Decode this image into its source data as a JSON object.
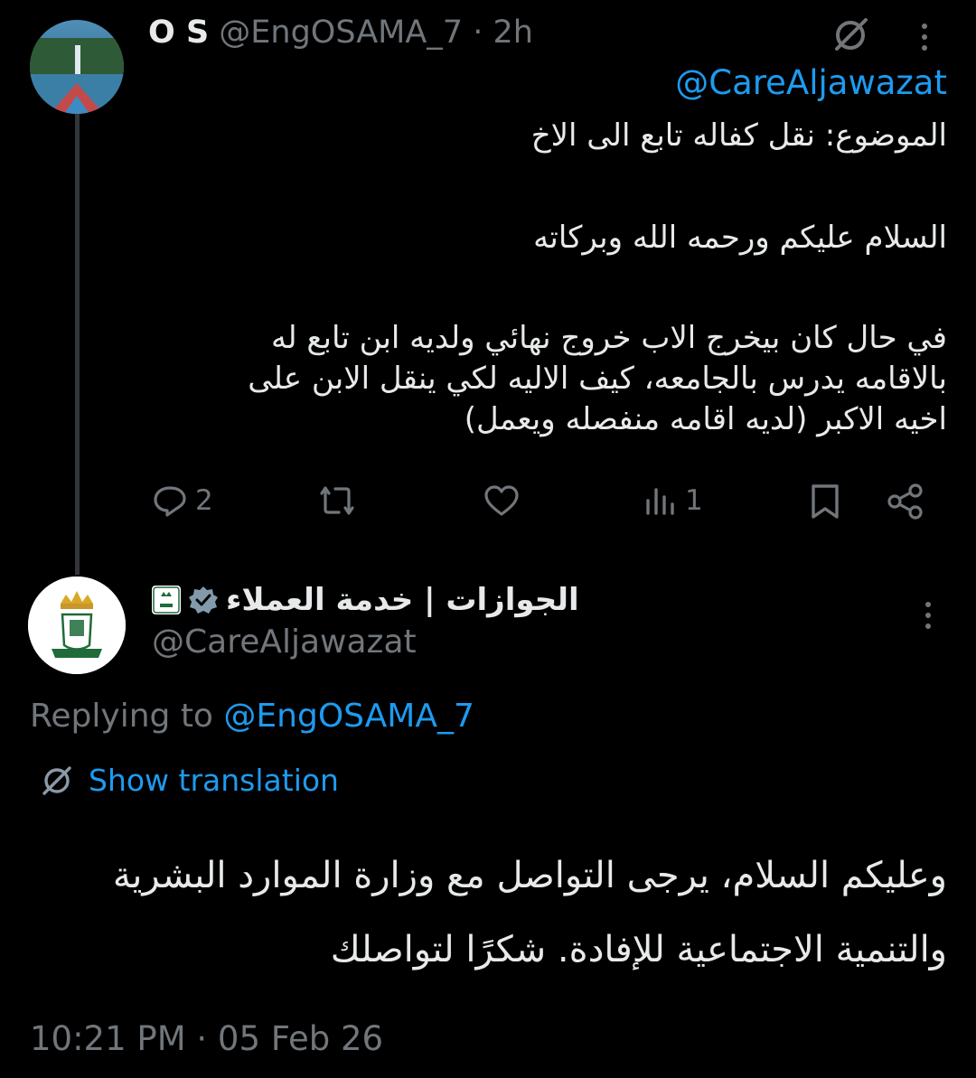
{
  "parent_tweet": {
    "display_name": "O S",
    "handle": "@EngOSAMA_7",
    "separator": "·",
    "time": "2h",
    "mention": "@CareAljawazat",
    "lines": [
      "الموضوع: نقل كفاله تابع الى الاخ",
      "السلام عليكم ورحمه الله وبركاته",
      "في حال كان بيخرج الاب خروج نهائي ولديه ابن تابع له",
      "بالاقامه يدرس بالجامعه، كيف الاليه لكي ينقل الابن على",
      "اخيه الاكبر (لديه اقامه منفصله ويعمل)"
    ],
    "actions": {
      "reply_count": "2",
      "retweet_count": "",
      "like_count": "",
      "views_count": "1"
    }
  },
  "reply_tweet": {
    "display_name": "الجوازات | خدمة العملاء",
    "handle": "@CareAljawazat",
    "replying_prefix": "Replying to ",
    "replying_handle": "@EngOSAMA_7",
    "show_translation": "Show translation",
    "lines": [
      "وعليكم السلام، يرجى التواصل مع وزارة الموارد البشرية",
      "والتنمية الاجتماعية للإفادة. شكرًا لتواصلك"
    ],
    "timestamp": "10:21 PM · 05 Feb 26"
  },
  "colors": {
    "background": "#000000",
    "text": "#e7e9ea",
    "muted": "#71767b",
    "link": "#1d9bf0",
    "verified": "#829aab"
  },
  "icons": [
    "grok-icon",
    "more-icon",
    "reply-icon",
    "retweet-icon",
    "like-icon",
    "views-icon",
    "bookmark-icon",
    "share-icon",
    "verified-badge-icon",
    "translate-icon"
  ]
}
